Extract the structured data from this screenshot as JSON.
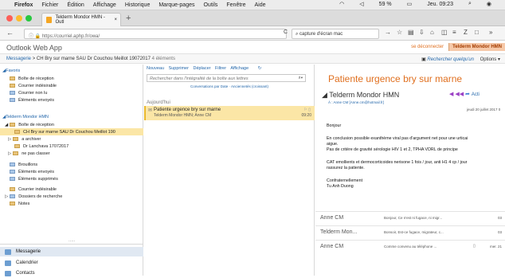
{
  "menubar": {
    "app": "Firefox",
    "items": [
      "Fichier",
      "Édition",
      "Affichage",
      "Historique",
      "Marque-pages",
      "Outils",
      "Fenêtre",
      "Aide"
    ],
    "battery": "59 %",
    "clock": "Jeu. 09:23"
  },
  "browser": {
    "tab_title": "Telderm Mondor HMN - Outl",
    "new_tab": "+",
    "url": "https://courriel.aphp.fr/owa/",
    "search_value": "capture d'écran mac",
    "back": "←",
    "reload": "C"
  },
  "owa": {
    "title": "Outlook Web App",
    "disconnect": "se déconnecter",
    "user": "Telderm Mondor HMN"
  },
  "breadcrumb": {
    "messagerie": "Messagerie",
    "sep": ">",
    "folder": "CH Bry sur marne SAU Dr Couchou Meillot 19072017",
    "count": "4 éléments",
    "search_people": "Rechercher quelqu'un",
    "options": "Options"
  },
  "sidebar": {
    "favoris": "Favoris",
    "inbox": "Boîte de réception",
    "junk": "Courrier indésirable",
    "unread": "Courrier non lu",
    "sent": "Éléments envoyés",
    "account": "Telderm Mondor HMN",
    "inbox2": "Boîte de réception",
    "ch_bry": "CH Bry sur marne SAU Dr Couchou Meillot 190",
    "archive": "a archiver",
    "lanchava": "Dr Lanchava 17072017",
    "ne_pas": "ne pas classer",
    "drafts": "Brouillons",
    "sent2": "Éléments envoyés",
    "deleted": "Éléments supprimés",
    "junk2": "Courrier indésirable",
    "search_folders": "Dossiers de recherche",
    "notes": "Notes",
    "dots": ".....",
    "nav_mail": "Messagerie",
    "nav_cal": "Calendrier",
    "nav_contacts": "Contacts"
  },
  "middle": {
    "toolbar": [
      "Nouveau",
      "Supprimer",
      "Déplacer",
      "Filtrer",
      "Affichage"
    ],
    "search_placeholder": "Rechercher dans l'intégralité de la boîte aux lettres",
    "conversations": "Conversations par Date · Anciennetés (croissant)",
    "day": "Aujourd'hui",
    "msg_subject": "Patiente urgence bry sur marne",
    "msg_from": "Telderm Mondor HMN; Anne CM",
    "msg_time": "09:20"
  },
  "reading": {
    "subject": "Patiente urgence bry sur marne",
    "sender": "Telderm Mondor HMN",
    "to": "À : Anne CM [Anne.cm@hotmail.fr]",
    "actions": "Acti",
    "date": "jeudi 20 juillet 2017 0",
    "body": [
      "Bonjour",
      "En conclusion possible exanthème viral pas d'argument net pour une urticai",
      "aigue.",
      "Pas de critère de gravité sérologie HIV 1 et 2, TPHA VDRL de principe",
      "CAT emollients et dermocorticoides nerisone 1 fois / jour, anti H1 4 cp / jour",
      "rassurez la patiente.",
      "Confraternellement",
      "Tu Anh Duong"
    ],
    "thread": [
      {
        "name": "Anne CM",
        "preview": "Bonjour, Ce n'est ni fugace, ni migr...",
        "date": "03"
      },
      {
        "name": "Telderm Mon...",
        "preview": "Bonsoir, Est-ce fugace, migrateur, c...",
        "date": "03"
      },
      {
        "name": "Anne CM",
        "preview": "Comme convenu au téléphone ...",
        "date": "mer. 21"
      }
    ]
  }
}
